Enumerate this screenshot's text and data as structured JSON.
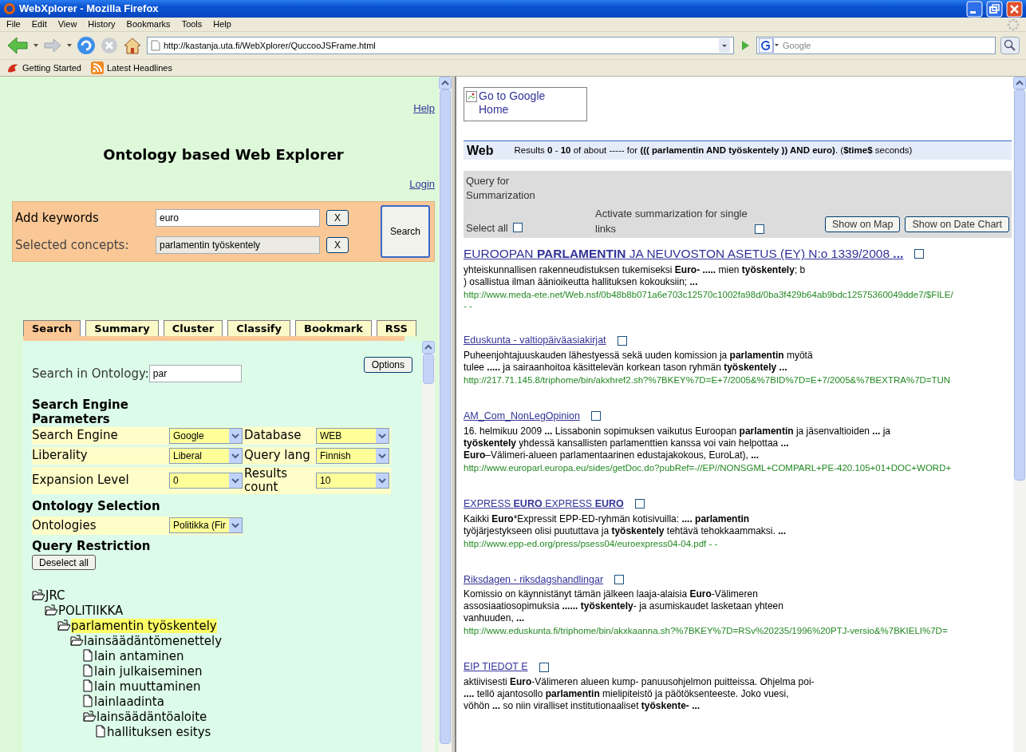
{
  "window": {
    "title": "WebXplorer - Mozilla Firefox"
  },
  "menu": [
    "File",
    "Edit",
    "View",
    "History",
    "Bookmarks",
    "Tools",
    "Help"
  ],
  "address_bar": {
    "url": "http://kastanja.uta.fi/WebXplorer/QuccooJSFrame.html"
  },
  "search_bar": {
    "placeholder": "Google"
  },
  "bookmarks": [
    "Getting Started",
    "Latest Headlines"
  ],
  "left": {
    "help_link": "Help",
    "title": "Ontology based Web Explorer",
    "login_link": "Login",
    "keywords": {
      "label": "Add keywords",
      "value": "euro",
      "clear": "X"
    },
    "concepts": {
      "label": "Selected concepts:",
      "value": "parlamentin työskentely",
      "clear": "X"
    },
    "search_button": "Search",
    "tabs": [
      {
        "label": "Search",
        "selected": true
      },
      {
        "label": "Summary",
        "selected": false
      },
      {
        "label": "Cluster",
        "selected": false
      },
      {
        "label": "Classify",
        "selected": false
      },
      {
        "label": "Bookmark",
        "selected": false
      },
      {
        "label": "RSS",
        "selected": false
      }
    ],
    "ontology_search": {
      "label": "Search in Ontology:",
      "value": "par"
    },
    "options_button": "Options",
    "engine_heading": "Search Engine Parameters",
    "param_rows": [
      {
        "cells": [
          {
            "label": "Search Engine",
            "value": "Google"
          },
          {
            "label": "Database",
            "value": "WEB"
          }
        ]
      },
      {
        "cells": [
          {
            "label": "Liberality",
            "value": "Liberal"
          },
          {
            "label": "Query lang",
            "value": "Finnish"
          }
        ]
      },
      {
        "cells": [
          {
            "label": "Expansion Level",
            "value": "0"
          },
          {
            "label": "Results count",
            "value": "10"
          }
        ]
      }
    ],
    "ontology_heading": "Ontology Selection",
    "ontologies": {
      "label": "Ontologies",
      "value": "Politikka (Fir"
    },
    "restriction_heading": "Query Restriction",
    "deselect_button": "Deselect all",
    "tree": [
      {
        "label": "JRC",
        "kind": "folder",
        "selected": false,
        "children": [
          {
            "label": "POLITIIKKA",
            "kind": "folder",
            "selected": false,
            "children": [
              {
                "label": "parlamentin työskentely",
                "kind": "folder",
                "selected": true,
                "children": [
                  {
                    "label": "lainsäädäntömenettely",
                    "kind": "folder",
                    "selected": false,
                    "children": [
                      {
                        "label": "lain antaminen",
                        "kind": "leaf",
                        "selected": false
                      },
                      {
                        "label": "lain julkaiseminen",
                        "kind": "leaf",
                        "selected": false
                      },
                      {
                        "label": "lain muuttaminen",
                        "kind": "leaf",
                        "selected": false
                      },
                      {
                        "label": "lainlaadinta",
                        "kind": "leaf",
                        "selected": false
                      },
                      {
                        "label": "lainsäädäntöaloite",
                        "kind": "folder",
                        "selected": false,
                        "children": [
                          {
                            "label": "hallituksen esitys",
                            "kind": "leaf",
                            "selected": false
                          }
                        ]
                      }
                    ]
                  }
                ]
              }
            ]
          }
        ]
      }
    ]
  },
  "right": {
    "google_home": "Go to Google Home",
    "web_label": "Web",
    "results_summary": "Results **0** - **10** of about ----- for **((( parlamentin AND työskentely )) AND euro)**. (**$time$** seconds)",
    "summarization": {
      "title": "Query for Summarization",
      "select_all": {
        "label": "Select all",
        "checked": false
      },
      "single_links": {
        "label": "Activate summarization for single links",
        "checked": false
      },
      "buttons": [
        "Show on Map",
        "Show on Date Chart"
      ]
    },
    "results": [
      {
        "title": "EUROOPAN **PARLAMENTIN** JA NEUVOSTON ASETUS (EY) N:o 1339/2008 **...**",
        "checked": false,
        "snippet_lines": [
          "yhteiskunnallisen rakenneudistuksen tukemiseksi **Euro- .....** mien **työskentely**; b",
          ") osallistua ilman äänioikeutta hallituksen kokouksiin; **...**"
        ],
        "url": "http://www.meda-ete.net/Web.nsf/0b48b8b071a6e703c12570c1002fa98d/0ba3f429b64ab9bdc12575360049dde7/$FILE/",
        "url_suffix": "- -"
      },
      {
        "title": "Eduskunta - valtiopäiväasiakirjat",
        "checked": false,
        "snippet_lines": [
          "Puheenjohtajuuskauden lähestyessä sekä uuden komission ja **parlamentin** myötä",
          "tulee **.....** ja sairaanhoitoa käsittelevän korkean tason ryhmän **työskentely ...**"
        ],
        "url": "http://217.71.145.8/triphome/bin/akxhref2.sh?%7BKEY%7D=E+7/2005&%7BID%7D=E+7/2005&%7BEXTRA%7D=TUN"
      },
      {
        "title": "AM_Com_NonLegOpinion",
        "checked": false,
        "snippet_lines": [
          "16. helmikuu 2009 **...** Lissabonin sopimuksen vaikutus Euroopan **parlamentin** ja jäsenvaltioiden **...** ja",
          "**työskentely** yhdessä kansallisten parlamenttien kanssa voi vain helpottaa **...**",
          "**Euro**–Välimeri-alueen parlamentaarinen edustajakokous, EuroLat), **...**"
        ],
        "url": "http://www.europarl.europa.eu/sides/getDoc.do?pubRef=-//EP//NONSGML+COMPARL+PE-420.105+01+DOC+WORD+"
      },
      {
        "title": "EXPRESS **EURO** EXPRESS **EURO**",
        "checked": false,
        "snippet_lines": [
          "Kaikki **Euro***Expressit EPP-ED-ryhmän kotisivuilla: **.... parlamentin**",
          "työjärjestykseen olisi puututtava ja **työskentely** tehtävä tehokkaammaksi. **...**"
        ],
        "url": "http://www.epp-ed.org/press/psess04/euroexpress04-04.pdf - -"
      },
      {
        "title": "Riksdagen - riksdagshandlingar",
        "checked": false,
        "snippet_lines": [
          "Komissio on käynnistänyt tämän jälkeen laaja-alaisia **Euro**-Välimeren",
          "assosiaatiosopimuksia **......** **työskentely**- ja asumiskaudet lasketaan yhteen",
          "vanhuuden, **...**"
        ],
        "url": "http://www.eduskunta.fi/triphome/bin/akxkaanna.sh?%7BKEY%7D=RSv%20235/1996%20PTJ-versio&%7BKIELI%7D="
      },
      {
        "title": "EIP TIEDOT E",
        "checked": false,
        "snippet_lines": [
          "aktiivisesti **Euro**-Välimeren alueen kump- panuusohjelmon puitteissa. Ohjelma poi-",
          "**....** tellö ajantosollo **parlamentin** mielipiteistö ja päötöksenteeste. Joko vuesi,",
          "vöhön **...** so niin viralliset institutionaaliset **työskente- ...**"
        ]
      }
    ]
  }
}
